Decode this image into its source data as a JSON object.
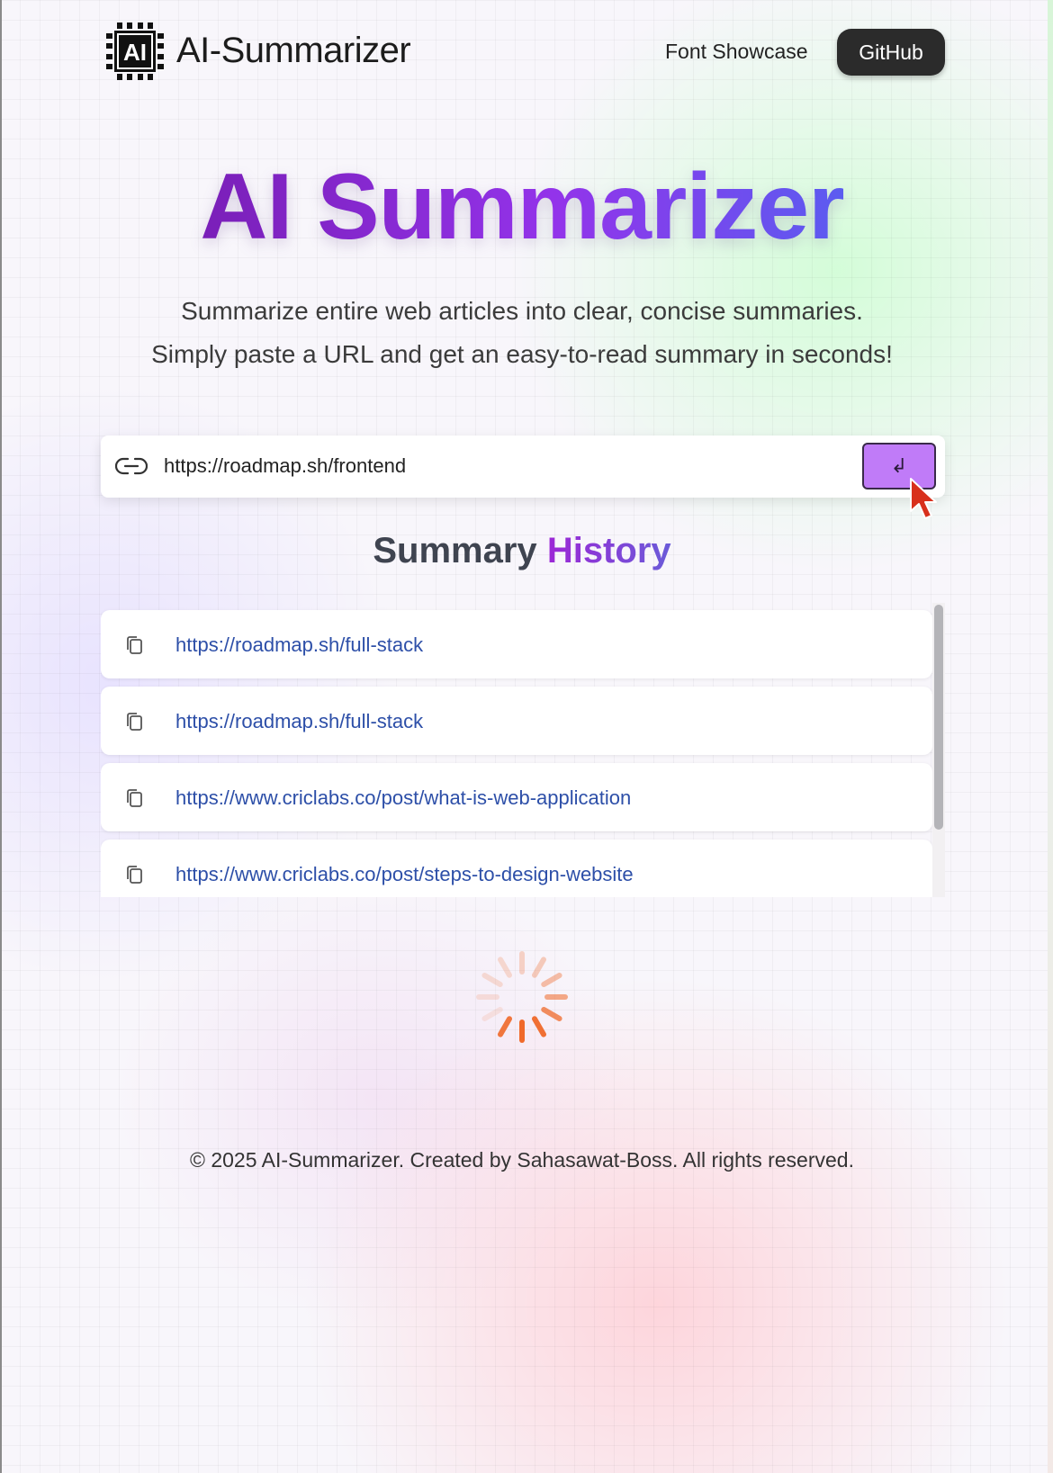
{
  "nav": {
    "logo_text": "AI",
    "brand": "AI-Summarizer",
    "font_showcase": "Font Showcase",
    "github": "GitHub"
  },
  "hero": {
    "title": "AI Summarizer",
    "subtitle_line1": "Summarize entire web articles into clear, concise summaries.",
    "subtitle_line2": "Simply paste a URL and get an easy-to-read summary in seconds!"
  },
  "url_form": {
    "value": "https://roadmap.sh/frontend",
    "submit_symbol": "↲"
  },
  "history": {
    "title_part1": "Summary",
    "title_part2": "History",
    "items": [
      {
        "url": "https://roadmap.sh/full-stack"
      },
      {
        "url": "https://roadmap.sh/full-stack"
      },
      {
        "url": "https://www.criclabs.co/post/what-is-web-application"
      },
      {
        "url": "https://www.criclabs.co/post/steps-to-design-website"
      }
    ]
  },
  "footer": {
    "text": "© 2025 AI-Summarizer. Created by Sahasawat-Boss. All rights reserved."
  },
  "colors": {
    "title_gradient_start": "#7a1fb8",
    "title_gradient_end": "#5b5cf0",
    "submit_button": "#c07bf8",
    "link": "#2d4fa8",
    "spinner": "#f06a2a",
    "github_button": "#2b2b2b"
  },
  "icons": {
    "logo": "ai-chip-icon",
    "url_field": "link-icon",
    "history_item": "copy-icon",
    "loading": "spinner-icon",
    "pointer": "cursor-arrow-icon"
  }
}
